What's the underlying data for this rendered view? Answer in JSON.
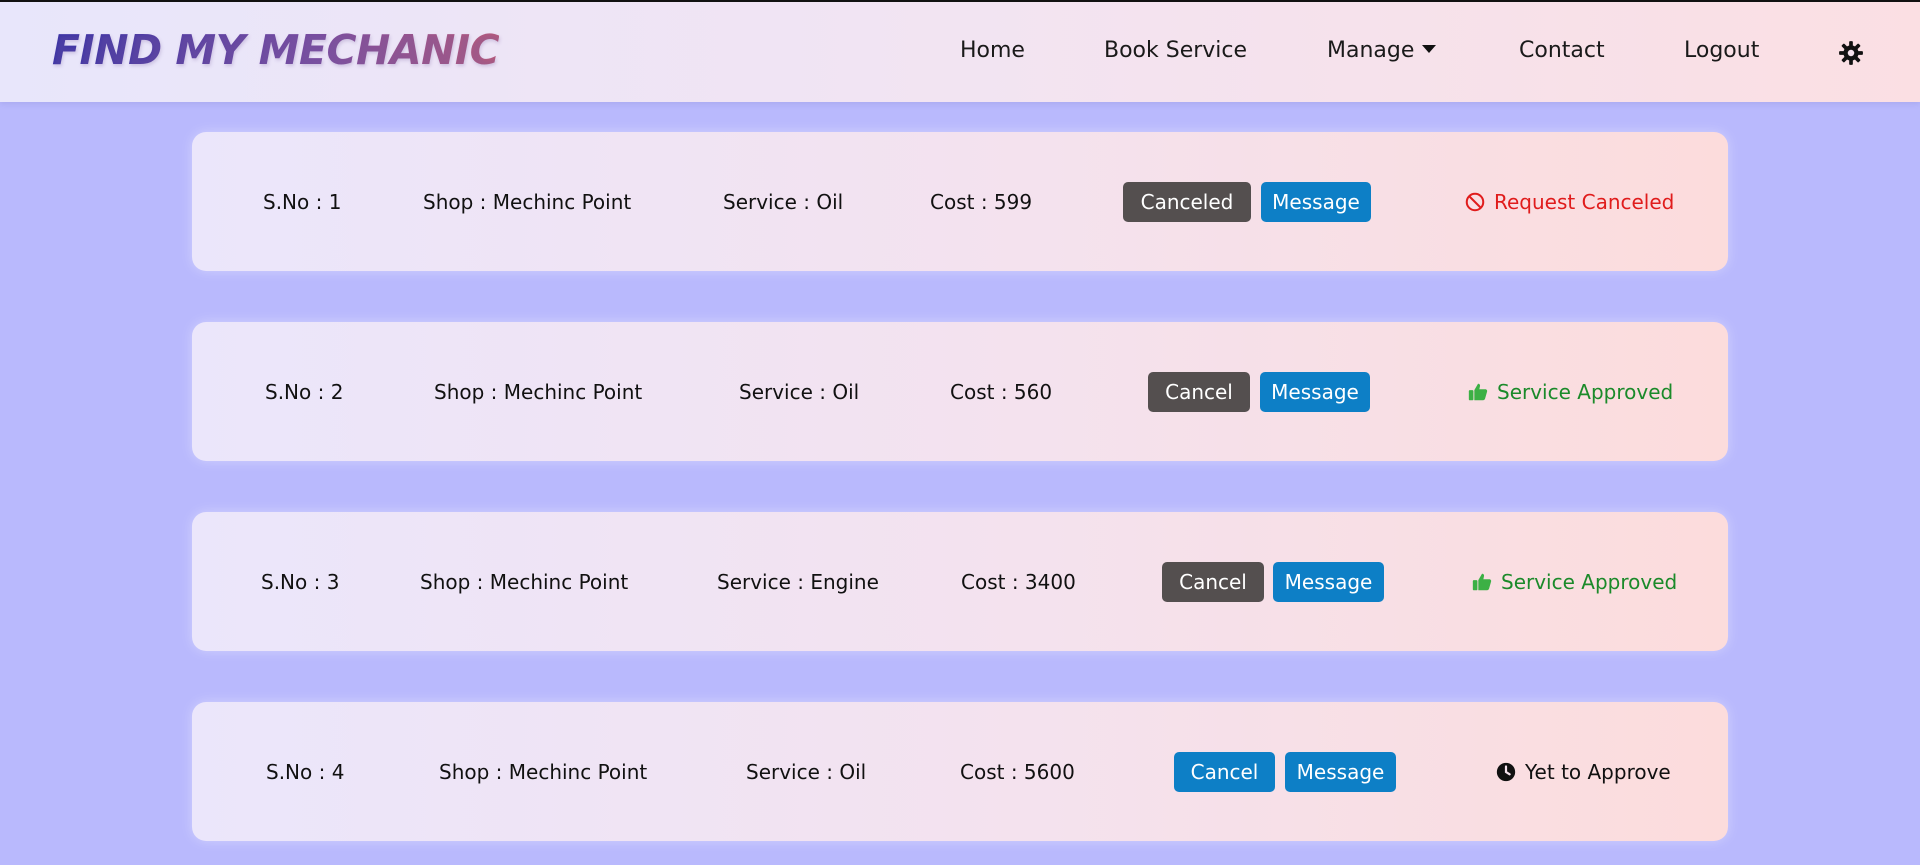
{
  "nav": {
    "logo": "FIND MY MECHANIC",
    "home": "Home",
    "book_service": "Book Service",
    "manage": "Manage",
    "contact": "Contact",
    "logout": "Logout",
    "settings_icon": "gear-icon"
  },
  "colors": {
    "page_bg": "#b9b9fd",
    "btn_dark": "#544f4f",
    "btn_blue": "#0d7fc6",
    "status_red": "#e01c1c",
    "status_green": "#1b8a2a"
  },
  "rows": [
    {
      "sno": "S.No : 1",
      "shop": "Shop : Mechinc Point",
      "service": "Service : Oil",
      "cost": "Cost : 599",
      "action_label": "Canceled",
      "message_label": "Message",
      "status_icon": "ban-icon",
      "status_text": "Request Canceled"
    },
    {
      "sno": "S.No : 2",
      "shop": "Shop : Mechinc Point",
      "service": "Service : Oil",
      "cost": "Cost : 560",
      "action_label": "Cancel",
      "message_label": "Message",
      "status_icon": "thumbs-up-icon",
      "status_text": "Service Approved"
    },
    {
      "sno": "S.No : 3",
      "shop": "Shop : Mechinc Point",
      "service": "Service : Engine",
      "cost": "Cost : 3400",
      "action_label": "Cancel",
      "message_label": "Message",
      "status_icon": "thumbs-up-icon",
      "status_text": "Service Approved"
    },
    {
      "sno": "S.No : 4",
      "shop": "Shop : Mechinc Point",
      "service": "Service : Oil",
      "cost": "Cost : 5600",
      "action_label": "Cancel",
      "message_label": "Message",
      "status_icon": "clock-icon",
      "status_text": "Yet to Approve"
    }
  ]
}
